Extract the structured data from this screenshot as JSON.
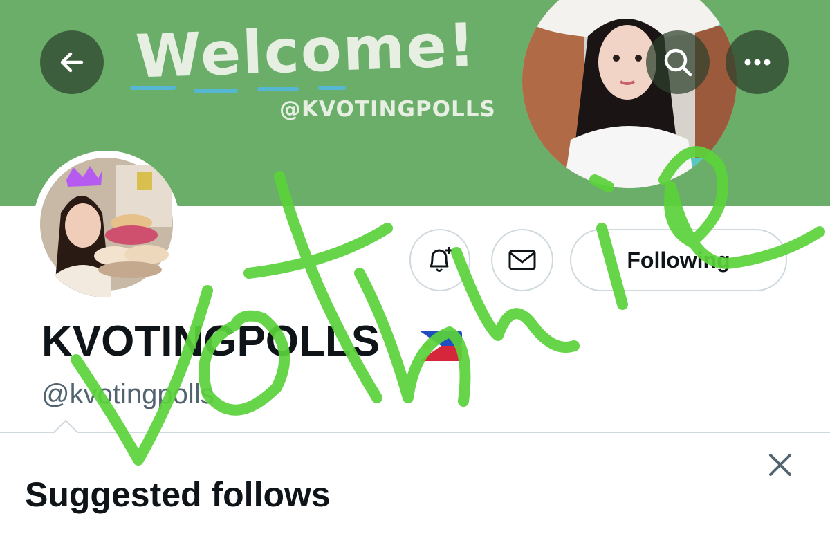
{
  "header": {
    "banner_title": "Welcome!",
    "banner_handle": "@KVOTINGPOLLS",
    "back_icon": "arrow-left-icon",
    "search_icon": "search-icon",
    "more_icon": "more-horizontal-icon"
  },
  "profile": {
    "display_name": "KVOTINGPOLLS",
    "flag_icon": "philippines-flag-icon",
    "handle": "@kvotingpolls"
  },
  "actions": {
    "notify_icon": "bell-plus-icon",
    "message_icon": "envelope-icon",
    "following_label": "Following"
  },
  "suggested": {
    "title": "Suggested follows",
    "close_icon": "close-icon"
  },
  "colors": {
    "banner": "#6aae6a",
    "scribble": "#5bd23a",
    "text_secondary": "#536471",
    "border": "#cfd9de"
  }
}
